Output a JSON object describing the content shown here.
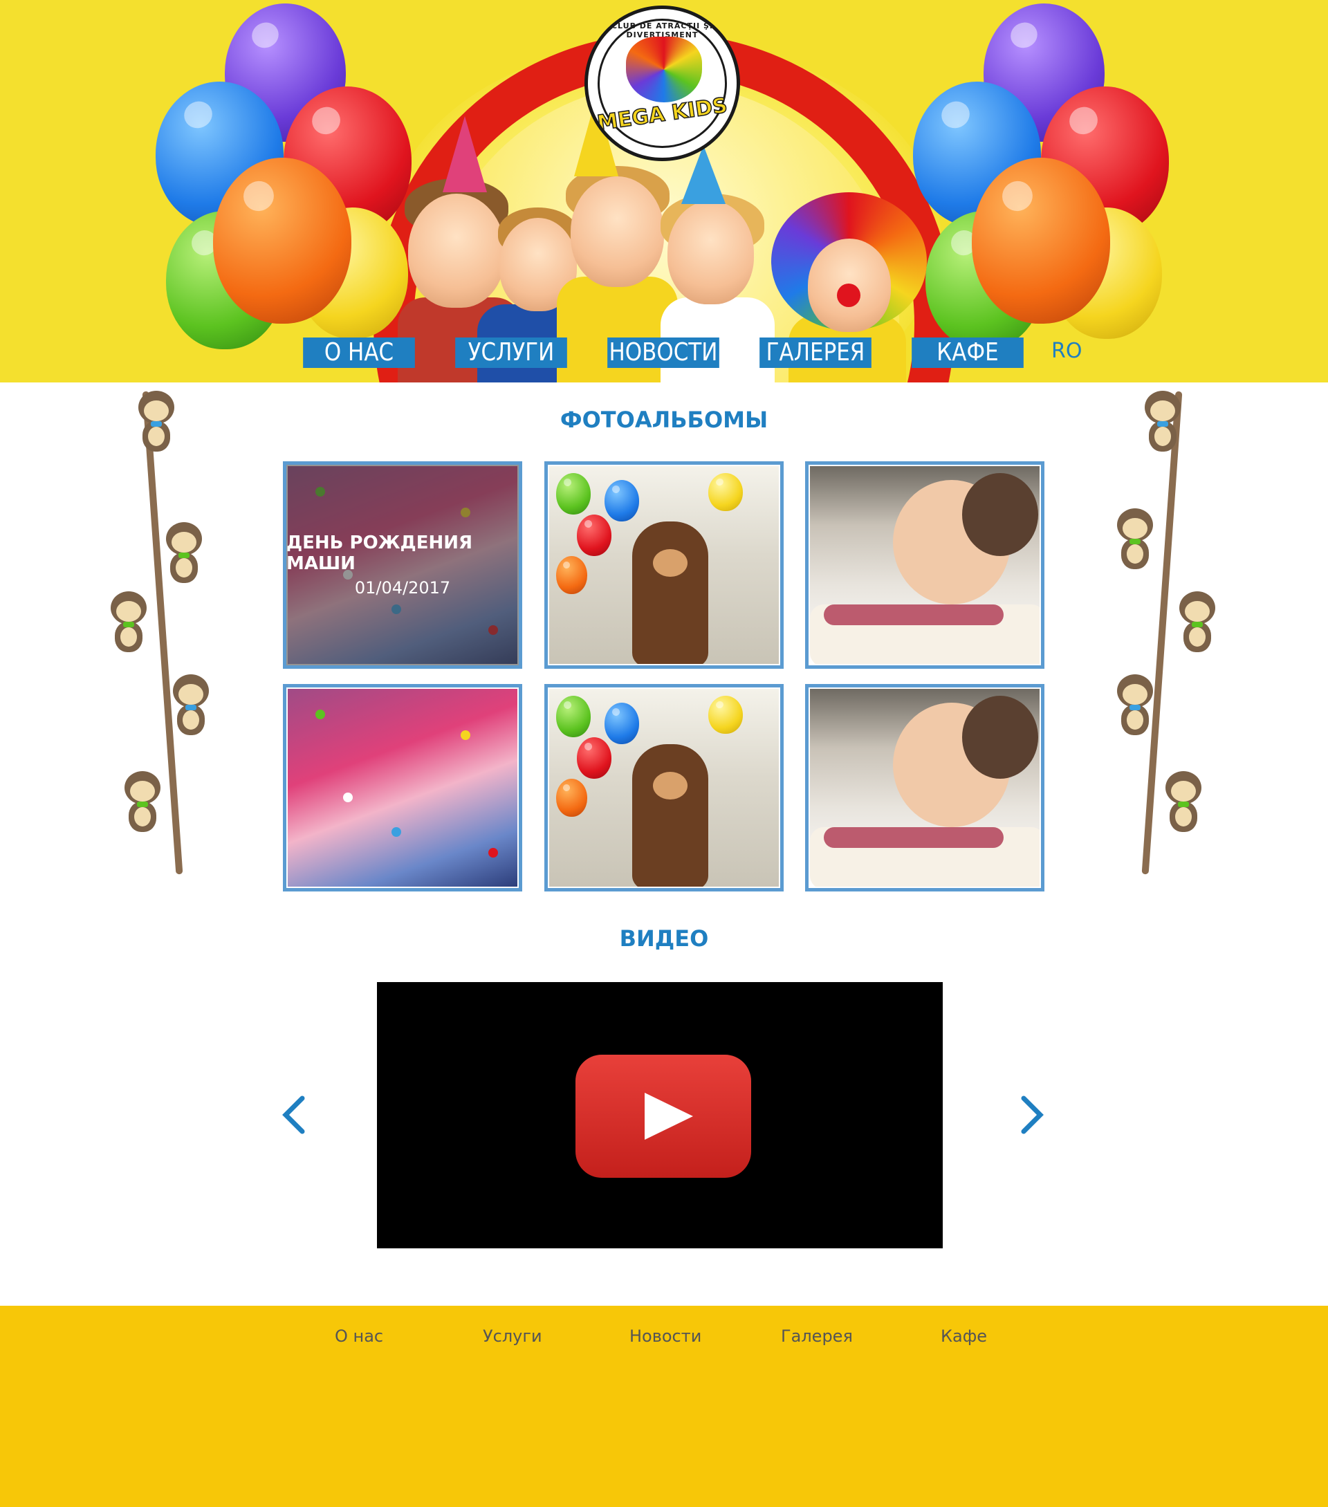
{
  "header": {
    "logo": {
      "top_text": "CLUB DE ATRACŢII ŞI DIVERTISMENT",
      "brand": "MEGA KIDS"
    },
    "nav": [
      {
        "label": "О НАС"
      },
      {
        "label": "УСЛУГИ"
      },
      {
        "label": "НОВОСТИ"
      },
      {
        "label": "ГАЛЕРЕЯ"
      },
      {
        "label": "КАФЕ"
      }
    ],
    "language": "RO"
  },
  "albums_section": {
    "title": "ФОТОАЛЬБОМЫ",
    "albums": [
      {
        "scene": "party",
        "hover_title": "ДЕНЬ РОЖДЕНИЯ МАШИ",
        "hover_date": "01/04/2017"
      },
      {
        "scene": "bear"
      },
      {
        "scene": "cake"
      },
      {
        "scene": "party"
      },
      {
        "scene": "bear"
      },
      {
        "scene": "cake"
      }
    ]
  },
  "video_section": {
    "title": "ВИДЕО",
    "prev_icon": "chevron-left-icon",
    "next_icon": "chevron-right-icon",
    "play_icon": "youtube-play-icon"
  },
  "footer": {
    "links": [
      {
        "label": "О нас"
      },
      {
        "label": "Услуги"
      },
      {
        "label": "Новости"
      },
      {
        "label": "Галерея"
      },
      {
        "label": "Кафе"
      }
    ]
  },
  "colors": {
    "header_bg": "#f4e02e",
    "accent_blue": "#1f7fc1",
    "album_border": "#5b9bd1",
    "footer_bg": "#f7c708",
    "arch_red": "#e01f14"
  }
}
